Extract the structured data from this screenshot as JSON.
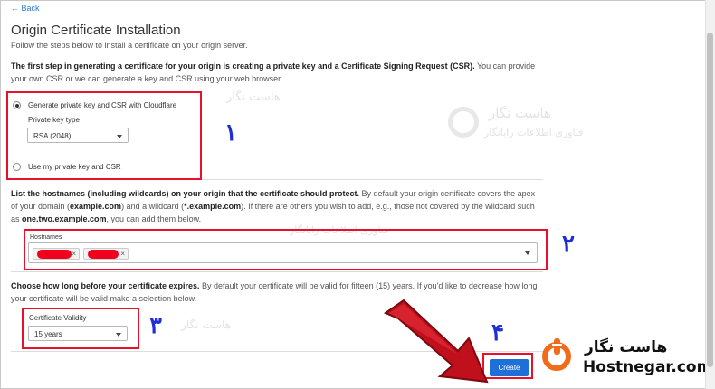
{
  "nav": {
    "back_label": "Back"
  },
  "header": {
    "title": "Origin Certificate Installation",
    "subtitle": "Follow the steps below to install a certificate on your origin server."
  },
  "step1": {
    "intro_bold": "The first step in generating a certificate for your origin is creating a private key and a Certificate Signing Request (CSR).",
    "intro_rest": " You can provide your own CSR or we can generate a key and CSR using your web browser.",
    "option_generate": "Generate private key and CSR with Cloudflare",
    "option_own": "Use my private key and CSR",
    "key_type_label": "Private key type",
    "key_type_value": "RSA (2048)",
    "selected_option": "generate"
  },
  "step2": {
    "intro_bold": "List the hostnames (including wildcards) on your origin that the certificate should protect.",
    "intro_rest_1": " By default your origin certificate covers the apex of your domain (",
    "apex_example": "example.com",
    "intro_rest_2": ") and a wildcard (",
    "wildcard_example": "*.example.com",
    "intro_rest_3": "). If there are others you wish to add, e.g., those not covered by the wildcard such as ",
    "other_example": "one.two.example.com",
    "intro_rest_4": ", you can add them below.",
    "hostnames_label": "Hostnames",
    "chip_remove": "×"
  },
  "step3": {
    "intro_bold": "Choose how long before your certificate expires.",
    "intro_rest": " By default your certificate will be valid for fifteen (15) years. If you'd like to decrease how long your certificate will be valid make a selection below.",
    "validity_label": "Certificate Validity",
    "validity_value": "15 years"
  },
  "actions": {
    "create_label": "Create"
  },
  "annotations": {
    "one": "۱",
    "two": "۲",
    "three": "۳",
    "four": "۴"
  },
  "watermark": {
    "brand_fa": "هاست نگار",
    "tagline_fa": "فناوری اطلاعات رایانگار"
  },
  "brand": {
    "name_fa": "هاست نگار",
    "domain": "Hostnegar.com",
    "accent": "#f26a1b"
  },
  "colors": {
    "highlight": "#e8102a",
    "annotation": "#1f2fd6",
    "primary_button": "#1e6fd8",
    "link": "#2c7cd1",
    "redaction": "#f0001c"
  }
}
